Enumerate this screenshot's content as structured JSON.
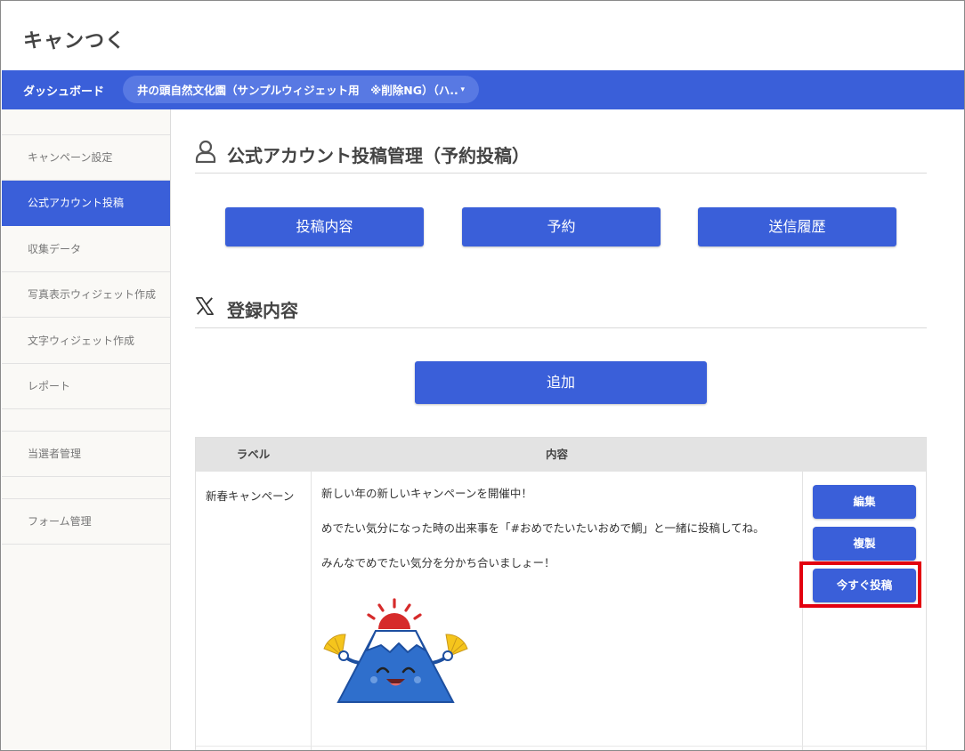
{
  "app": {
    "title": "キャンつく"
  },
  "navbar": {
    "dashboard_label": "ダッシュボード",
    "project_select": "井の頭自然文化園（サンプルウィジェット用　※削除NG）（ハ..",
    "caret": "▾"
  },
  "sidebar": {
    "items": [
      {
        "label": "キャンペーン設定",
        "active": false
      },
      {
        "label": "公式アカウント投稿",
        "active": true
      },
      {
        "label": "収集データ",
        "active": false
      },
      {
        "label": "写真表示ウィジェット作成",
        "active": false
      },
      {
        "label": "文字ウィジェット作成",
        "active": false
      },
      {
        "label": "レポート",
        "active": false
      },
      {
        "label": "当選者管理",
        "active": false
      },
      {
        "label": "フォーム管理",
        "active": false
      }
    ]
  },
  "main": {
    "page_title": "公式アカウント投稿管理（予約投稿）",
    "tabs": [
      "投稿内容",
      "予約",
      "送信履歴"
    ],
    "section_title": "登録内容",
    "add_button": "追加",
    "table": {
      "headers": {
        "label": "ラベル",
        "content": "内容",
        "actions": ""
      },
      "rows": [
        {
          "label": "新春キャンペーン",
          "content": [
            "新しい年の新しいキャンペーンを開催中！",
            "めでたい気分になった時の出来事を「#おめでたいたいおめで鯛」と一緒に投稿してね。",
            "みんなでめでたい気分を分かち合いましょー！"
          ],
          "actions": {
            "edit": "編集",
            "duplicate": "複製",
            "post_now": "今すぐ投稿"
          }
        }
      ]
    }
  },
  "colors": {
    "primary": "#3a5fd9",
    "highlight": "#e3000f",
    "sidebar_bg": "#faf9f6",
    "table_header_bg": "#e3e3e3"
  },
  "icons": {
    "page_title": "user-icon",
    "section": "x-logo-icon",
    "post_image": "mount-fuji-mascot-illustration"
  }
}
